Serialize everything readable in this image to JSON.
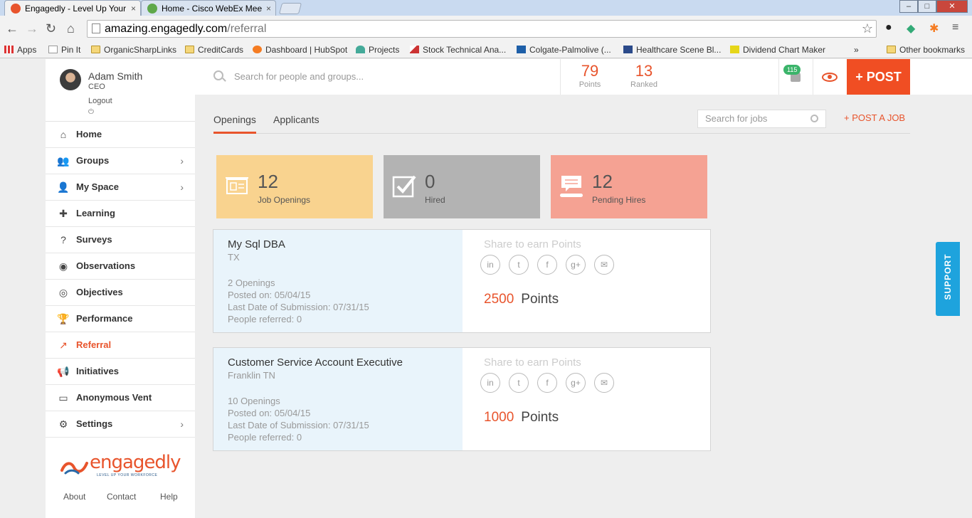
{
  "browser": {
    "tabs": [
      {
        "label": "Engagedly - Level Up Your",
        "close": "×"
      },
      {
        "label": "Home - Cisco WebEx Mee",
        "close": "×"
      }
    ],
    "url_domain": "amazing.engagedly.com",
    "url_path": "/referral",
    "bookmarks": [
      "Apps",
      "Pin It",
      "OrganicSharpLinks",
      "CreditCards",
      "Dashboard | HubSpot",
      "Projects",
      "Stock Technical Ana...",
      "Colgate-Palmolive (...",
      "Healthcare Scene Bl...",
      "Dividend Chart Maker",
      "»",
      "Other bookmarks"
    ]
  },
  "user": {
    "name": "Adam Smith",
    "role": "CEO",
    "logout": "Logout",
    "power": "⏻"
  },
  "menu": [
    {
      "label": "Home",
      "icon": "home-icon",
      "glyph": "⌂",
      "chev": ""
    },
    {
      "label": "Groups",
      "icon": "groups-icon",
      "glyph": "👥",
      "chev": "›"
    },
    {
      "label": "My Space",
      "icon": "user-icon",
      "glyph": "👤",
      "chev": "›"
    },
    {
      "label": "Learning",
      "icon": "puzzle-icon",
      "glyph": "✚",
      "chev": ""
    },
    {
      "label": "Surveys",
      "icon": "question-icon",
      "glyph": "?",
      "chev": ""
    },
    {
      "label": "Observations",
      "icon": "eye-icon",
      "glyph": "◉",
      "chev": ""
    },
    {
      "label": "Objectives",
      "icon": "target-icon",
      "glyph": "◎",
      "chev": ""
    },
    {
      "label": "Performance",
      "icon": "trophy-icon",
      "glyph": "🏆",
      "chev": ""
    },
    {
      "label": "Referral",
      "icon": "referral-icon",
      "glyph": "↗",
      "chev": ""
    },
    {
      "label": "Initiatives",
      "icon": "megaphone-icon",
      "glyph": "📢",
      "chev": ""
    },
    {
      "label": "Anonymous Vent",
      "icon": "inbox-icon",
      "glyph": "▭",
      "chev": ""
    },
    {
      "label": "Settings",
      "icon": "gear-icon",
      "glyph": "⚙",
      "chev": "›"
    }
  ],
  "active_menu": "Referral",
  "logo": {
    "word": "engagedly",
    "tagline": "LEVEL UP YOUR WORKFORCE"
  },
  "footer": {
    "about": "About",
    "contact": "Contact",
    "help": "Help"
  },
  "topbar": {
    "search_placeholder": "Search for people and groups...",
    "points_value": "79",
    "points_label": "Points",
    "ranked_value": "13",
    "ranked_label": "Ranked",
    "notifications": "115",
    "post_label": "+ POST"
  },
  "tabs": {
    "openings": "Openings",
    "applicants": "Applicants"
  },
  "job_search_placeholder": "Search for jobs",
  "post_job_label": "+ POST A JOB",
  "summary": [
    {
      "value": "12",
      "label": "Job Openings",
      "color": "#f9d38f"
    },
    {
      "value": "0",
      "label": "Hired",
      "color": "#b3b3b3"
    },
    {
      "value": "12",
      "label": "Pending Hires",
      "color": "#f5a293"
    }
  ],
  "jobs": [
    {
      "title": "My Sql DBA",
      "location": "TX",
      "openings": "2 Openings",
      "posted": "Posted on: 05/04/15",
      "last_date": "Last Date of Submission: 07/31/15",
      "referred": "People referred: 0",
      "share_label": "Share to earn Points",
      "points": "2500",
      "points_label": "Points"
    },
    {
      "title": "Customer Service Account Executive",
      "location": "Franklin TN",
      "openings": "10 Openings",
      "posted": "Posted on: 05/04/15",
      "last_date": "Last Date of Submission: 07/31/15",
      "referred": "People referred: 0",
      "share_label": "Share to earn Points",
      "points": "1000",
      "points_label": "Points"
    }
  ],
  "share_icons": [
    "in",
    "t",
    "f",
    "g+",
    "✉"
  ],
  "support_label": "SUPPORT"
}
